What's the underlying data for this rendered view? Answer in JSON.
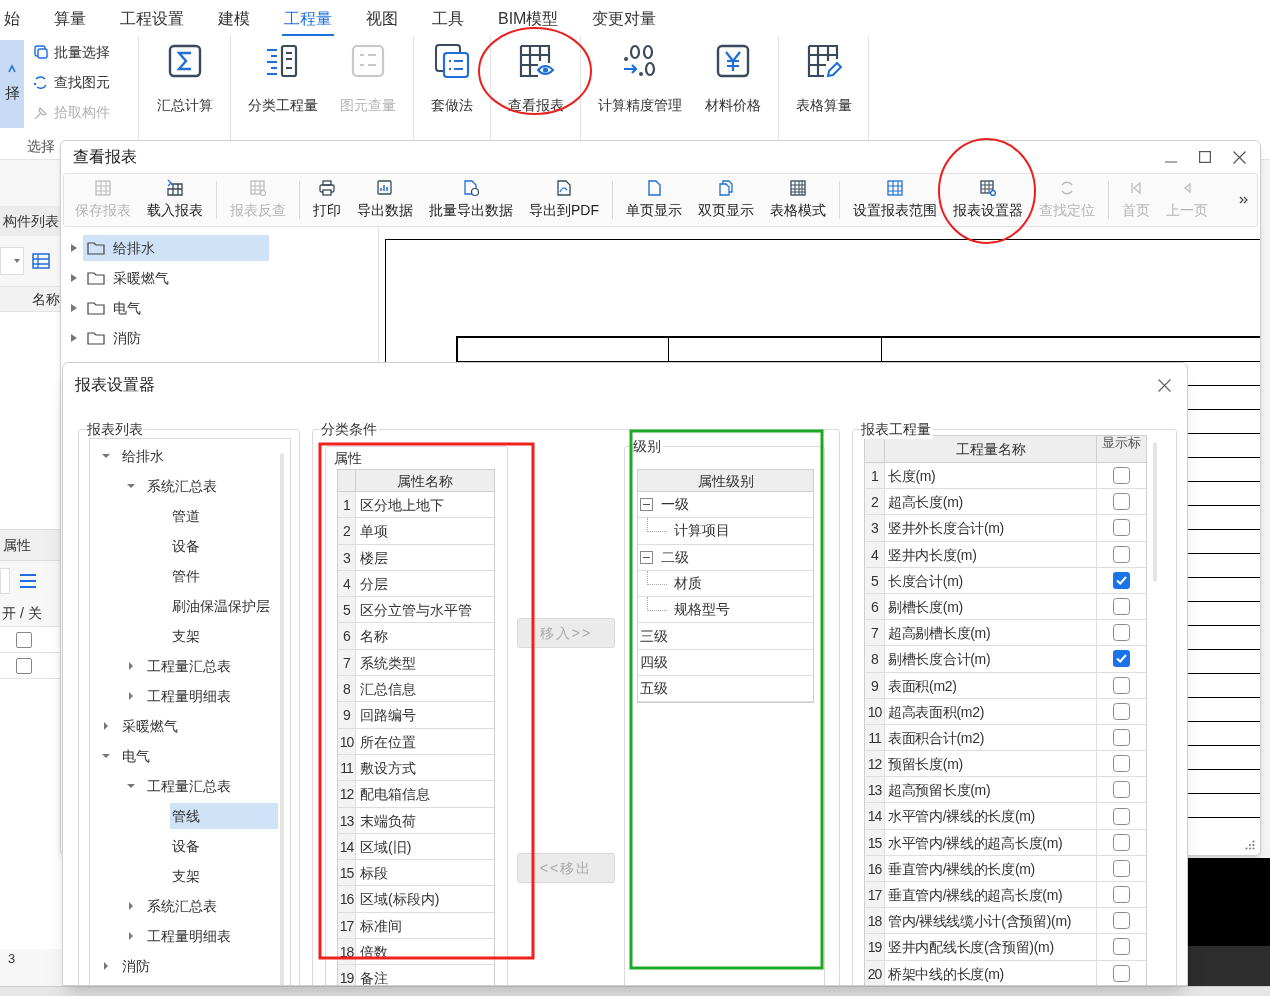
{
  "menu": [
    {
      "label": "始",
      "selected": false
    },
    {
      "label": "算量",
      "selected": false
    },
    {
      "label": "工程设置",
      "selected": false
    },
    {
      "label": "建模",
      "selected": false
    },
    {
      "label": "工程量",
      "selected": true
    },
    {
      "label": "视图",
      "selected": false
    },
    {
      "label": "工具",
      "selected": false
    },
    {
      "label": "BIM模型",
      "selected": false
    },
    {
      "label": "变更对量",
      "selected": false
    }
  ],
  "ribbon": {
    "select_group": {
      "big_button": "择",
      "items": [
        {
          "label": "批量选择",
          "disabled": false
        },
        {
          "label": "查找图元",
          "disabled": false
        },
        {
          "label": "拾取构件",
          "disabled": true
        }
      ],
      "group_label": "选择"
    },
    "groups": [
      [
        {
          "label": "汇总计算",
          "disabled": false
        }
      ],
      [
        {
          "label": "分类工程量",
          "disabled": false
        },
        {
          "label": "图元查量",
          "disabled": true
        }
      ],
      [
        {
          "label": "套做法",
          "disabled": false
        }
      ],
      [
        {
          "label": "查看报表",
          "disabled": false
        }
      ],
      [
        {
          "label": "计算精度管理",
          "disabled": false
        },
        {
          "label": "材料价格",
          "disabled": false
        }
      ],
      [
        {
          "label": "表格算量",
          "disabled": false
        }
      ]
    ]
  },
  "side_panel": {
    "tab": "构件列表",
    "column": "名称",
    "properties_tab": "属性",
    "toggle_header": "开 / 关",
    "toggles": [
      {
        "checked": false
      },
      {
        "checked": false
      }
    ],
    "row_number": "3"
  },
  "report_window": {
    "title": "查看报表",
    "toolbar": [
      {
        "label": "保存报表",
        "disabled": true,
        "separator_after": false
      },
      {
        "label": "载入报表",
        "disabled": false,
        "separator_after": true
      },
      {
        "label": "报表反查",
        "disabled": true,
        "separator_after": true
      },
      {
        "label": "打印",
        "disabled": false,
        "separator_after": false
      },
      {
        "label": "导出数据",
        "disabled": false,
        "separator_after": false
      },
      {
        "label": "批量导出数据",
        "disabled": false,
        "separator_after": false
      },
      {
        "label": "导出到PDF",
        "disabled": false,
        "separator_after": true
      },
      {
        "label": "单页显示",
        "disabled": false,
        "separator_after": false
      },
      {
        "label": "双页显示",
        "disabled": false,
        "separator_after": false
      },
      {
        "label": "表格模式",
        "disabled": false,
        "separator_after": true
      },
      {
        "label": "设置报表范围",
        "disabled": false,
        "separator_after": false
      },
      {
        "label": "报表设置器",
        "disabled": false,
        "separator_after": false
      },
      {
        "label": "查找定位",
        "disabled": true,
        "separator_after": true
      },
      {
        "label": "首页",
        "disabled": true,
        "separator_after": false
      },
      {
        "label": "上一页",
        "disabled": true,
        "separator_after": false
      }
    ],
    "tree": [
      {
        "label": "给排水",
        "selected": true
      },
      {
        "label": "采暖燃气",
        "selected": false
      },
      {
        "label": "电气",
        "selected": false
      },
      {
        "label": "消防",
        "selected": false
      }
    ]
  },
  "settings_dialog": {
    "title": "报表设置器",
    "report_list": {
      "label": "报表列表",
      "tree": [
        {
          "label": "给排水",
          "selected": false,
          "expanded": true,
          "children": [
            {
              "label": "系统汇总表",
              "selected": false,
              "expanded": true,
              "children": [
                {
                  "label": "管道",
                  "selected": false
                },
                {
                  "label": "设备",
                  "selected": false
                },
                {
                  "label": "管件",
                  "selected": false
                },
                {
                  "label": "刷油保温保护层",
                  "selected": false
                },
                {
                  "label": "支架",
                  "selected": false
                }
              ]
            },
            {
              "label": "工程量汇总表",
              "selected": false,
              "expanded": false
            },
            {
              "label": "工程量明细表",
              "selected": false,
              "expanded": false
            }
          ]
        },
        {
          "label": "采暖燃气",
          "selected": false,
          "expanded": false
        },
        {
          "label": "电气",
          "selected": false,
          "expanded": true,
          "children": [
            {
              "label": "工程量汇总表",
              "selected": false,
              "expanded": true,
              "children": [
                {
                  "label": "管线",
                  "selected": true
                },
                {
                  "label": "设备",
                  "selected": false
                },
                {
                  "label": "支架",
                  "selected": false
                }
              ]
            },
            {
              "label": "系统汇总表",
              "selected": false,
              "expanded": false
            },
            {
              "label": "工程量明细表",
              "selected": false,
              "expanded": false
            }
          ]
        },
        {
          "label": "消防",
          "selected": false,
          "expanded": false
        }
      ]
    },
    "classification": {
      "label": "分类条件",
      "attributes": {
        "label": "属性",
        "header": "属性名称",
        "rows": [
          {
            "number": "1",
            "name": "区分地上地下"
          },
          {
            "number": "2",
            "name": "单项"
          },
          {
            "number": "3",
            "name": "楼层"
          },
          {
            "number": "4",
            "name": "分层"
          },
          {
            "number": "5",
            "name": "区分立管与水平管"
          },
          {
            "number": "6",
            "name": "名称"
          },
          {
            "number": "7",
            "name": "系统类型"
          },
          {
            "number": "8",
            "name": "汇总信息"
          },
          {
            "number": "9",
            "name": "回路编号"
          },
          {
            "number": "10",
            "name": "所在位置"
          },
          {
            "number": "11",
            "name": "敷设方式"
          },
          {
            "number": "12",
            "name": "配电箱信息"
          },
          {
            "number": "13",
            "name": "末端负荷"
          },
          {
            "number": "14",
            "name": "区域(旧)"
          },
          {
            "number": "15",
            "name": "标段"
          },
          {
            "number": "16",
            "name": "区域(标段内)"
          },
          {
            "number": "17",
            "name": "标准间"
          },
          {
            "number": "18",
            "name": "倍数"
          },
          {
            "number": "19",
            "name": "备注"
          }
        ]
      },
      "move_in": {
        "label": "移入>>",
        "disabled": true
      },
      "move_out": {
        "label": "<<移出",
        "disabled": true
      },
      "levels": {
        "label": "级别",
        "header": "属性级别",
        "tree": [
          {
            "label": "一级",
            "expanded": true,
            "children": [
              {
                "label": "计算项目"
              }
            ]
          },
          {
            "label": "二级",
            "expanded": true,
            "children": [
              {
                "label": "材质"
              },
              {
                "label": "规格型号"
              }
            ]
          },
          {
            "label": "三级"
          },
          {
            "label": "四级"
          },
          {
            "label": "五级"
          }
        ]
      }
    },
    "quantities": {
      "label": "报表工程量",
      "columns": [
        "工程量名称",
        "显示标"
      ],
      "rows": [
        {
          "number": "1",
          "name": "长度(m)",
          "checked": false
        },
        {
          "number": "2",
          "name": "超高长度(m)",
          "checked": false
        },
        {
          "number": "3",
          "name": "竖井外长度合计(m)",
          "checked": false
        },
        {
          "number": "4",
          "name": "竖井内长度(m)",
          "checked": false
        },
        {
          "number": "5",
          "name": "长度合计(m)",
          "checked": true
        },
        {
          "number": "6",
          "name": "剔槽长度(m)",
          "checked": false
        },
        {
          "number": "7",
          "name": "超高剔槽长度(m)",
          "checked": false
        },
        {
          "number": "8",
          "name": "剔槽长度合计(m)",
          "checked": true
        },
        {
          "number": "9",
          "name": "表面积(m2)",
          "checked": false
        },
        {
          "number": "10",
          "name": "超高表面积(m2)",
          "checked": false
        },
        {
          "number": "11",
          "name": "表面积合计(m2)",
          "checked": false
        },
        {
          "number": "12",
          "name": "预留长度(m)",
          "checked": false
        },
        {
          "number": "13",
          "name": "超高预留长度(m)",
          "checked": false
        },
        {
          "number": "14",
          "name": "水平管内/裸线的长度(m)",
          "checked": false
        },
        {
          "number": "15",
          "name": "水平管内/裸线的超高长度(m)",
          "checked": false
        },
        {
          "number": "16",
          "name": "垂直管内/裸线的长度(m)",
          "checked": false
        },
        {
          "number": "17",
          "name": "垂直管内/裸线的超高长度(m)",
          "checked": false
        },
        {
          "number": "18",
          "name": "管内/裸线线缆小计(含预留)(m)",
          "checked": false
        },
        {
          "number": "19",
          "name": "竖井内配线长度(含预留)(m)",
          "checked": false
        },
        {
          "number": "20",
          "name": "桥架中线的长度(m)",
          "checked": false
        }
      ]
    }
  },
  "annotations": [
    {
      "kind": "ellipse",
      "color": "#e8201e"
    },
    {
      "kind": "ellipse",
      "color": "#e8201e"
    },
    {
      "kind": "rect",
      "color": "#f0201c"
    },
    {
      "kind": "rect",
      "color": "#1fa824"
    }
  ]
}
